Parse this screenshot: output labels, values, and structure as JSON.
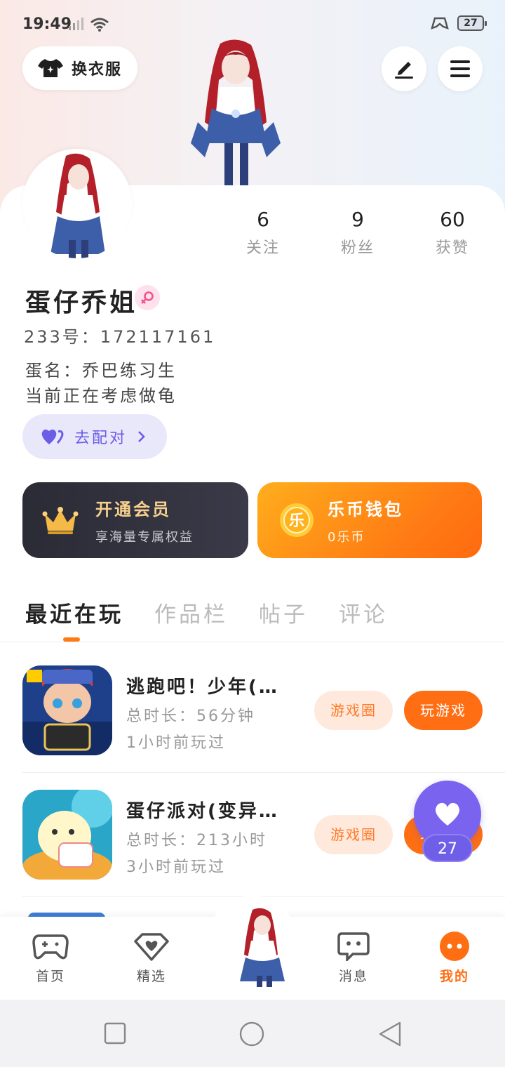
{
  "status_bar": {
    "time": "19:49",
    "battery": "27"
  },
  "header": {
    "outfit_button": "换衣服"
  },
  "stats": [
    {
      "value": "6",
      "label": "关注"
    },
    {
      "value": "9",
      "label": "粉丝"
    },
    {
      "value": "60",
      "label": "获赞"
    }
  ],
  "profile": {
    "name": "蛋仔乔姐",
    "uid": "233号：172117161",
    "bio_line1": "蛋名：乔巴练习生",
    "bio_line2": "当前正在考虑做龟",
    "match_button": "去配对"
  },
  "vip": {
    "title": "开通会员",
    "subtitle": "享海量专属权益"
  },
  "wallet": {
    "title": "乐币钱包",
    "subtitle": "0乐币",
    "coin_glyph": "乐"
  },
  "tabs": [
    "最近在玩",
    "作品栏",
    "帖子",
    "评论"
  ],
  "games": [
    {
      "name": "逃跑吧！少年(…",
      "duration": "总时长：56分钟",
      "last_played": "1小时前玩过",
      "circle_label": "游戏圈",
      "play_label": "玩游戏"
    },
    {
      "name": "蛋仔派对(变异…",
      "duration": "总时长：213小时",
      "last_played": "3小时前玩过",
      "circle_label": "游戏圈",
      "play_label": "玩游戏"
    }
  ],
  "float_like": {
    "count": "27"
  },
  "bottom_nav": [
    {
      "label": "首页",
      "icon": "gamepad-icon"
    },
    {
      "label": "精选",
      "icon": "heart-box-icon"
    },
    {
      "label": "消息",
      "icon": "chat-icon"
    },
    {
      "label": "我的",
      "icon": "profile-dots-icon"
    }
  ],
  "colors": {
    "accent": "#ff6e13",
    "purple": "#7a63ef",
    "vip_dark": "#2b2b36"
  }
}
